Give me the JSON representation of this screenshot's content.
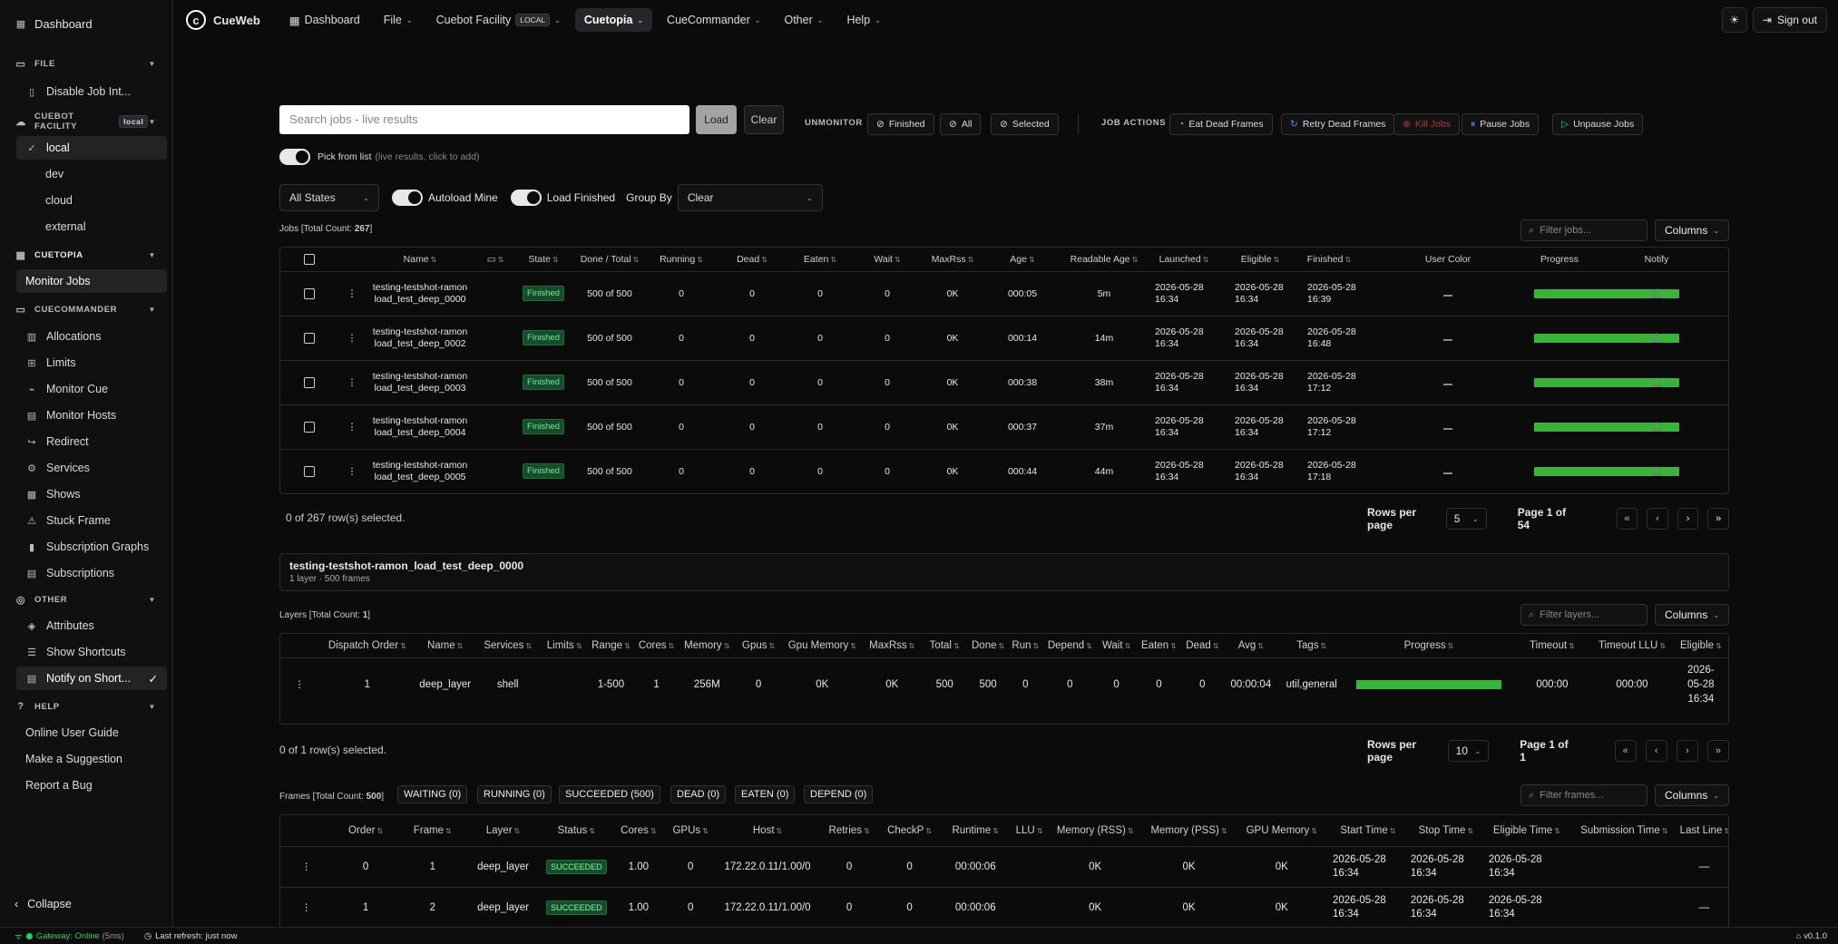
{
  "sidebar": {
    "dashboard": "Dashboard",
    "file": "FILE",
    "disable_job": "Disable Job Int...",
    "cuebot_facility": "CUEBOT FACILITY",
    "facility_tag": "local",
    "facilities": [
      "local",
      "dev",
      "cloud",
      "external"
    ],
    "cuetopia": "CUETOPIA",
    "monitor_jobs": "Monitor Jobs",
    "cuecommander": "CUECOMMANDER",
    "cc_items": [
      "Allocations",
      "Limits",
      "Monitor Cue",
      "Monitor Hosts",
      "Redirect",
      "Services",
      "Shows",
      "Stuck Frame",
      "Subscription Graphs",
      "Subscriptions"
    ],
    "other": "OTHER",
    "other_items": [
      "Attributes",
      "Show Shortcuts",
      "Notify on Short..."
    ],
    "help": "HELP",
    "help_items": [
      "Online User Guide",
      "Make a Suggestion",
      "Report a Bug"
    ],
    "collapse": "Collapse"
  },
  "topbar": {
    "brand": "CueWeb",
    "nav": [
      "Dashboard",
      "File",
      "Cuebot Facility",
      "Cuetopia",
      "CueCommander",
      "Other",
      "Help"
    ],
    "facility_tag": "LOCAL",
    "sign_out": "Sign out"
  },
  "search": {
    "placeholder": "Search jobs - live results",
    "load": "Load",
    "clear": "Clear",
    "pick": "Pick from list",
    "pick_hint": "(live results, click to add)"
  },
  "unmonitor": {
    "label": "UNMONITOR",
    "finished": "Finished",
    "all": "All",
    "selected": "Selected"
  },
  "job_actions": {
    "label": "JOB ACTIONS",
    "eat": "Eat Dead Frames",
    "retry": "Retry Dead Frames",
    "kill": "Kill Jobs",
    "pause": "Pause Jobs",
    "unpause": "Unpause Jobs"
  },
  "filters": {
    "state": "All States",
    "autoload": "Autoload Mine",
    "load_finished": "Load Finished",
    "group_by": "Group By",
    "group_value": "Clear"
  },
  "jobs": {
    "title": "Jobs [Total Count: ",
    "count": "267",
    "title_end": "]",
    "filter_placeholder": "Filter jobs...",
    "columns": "Columns",
    "headers": [
      "Name",
      "",
      "State",
      "Done / Total",
      "Running",
      "Dead",
      "Eaten",
      "Wait",
      "MaxRss",
      "Age",
      "Readable Age",
      "Launched",
      "Eligible",
      "Finished",
      "User Color",
      "Progress",
      "Notify"
    ],
    "rows": [
      {
        "name1": "testing-testshot-ramon",
        "name2": "load_test_deep_0000",
        "state": "Finished",
        "done": "500 of 500",
        "running": "0",
        "dead": "0",
        "eaten": "0",
        "wait": "0",
        "maxrss": "0K",
        "age": "000:05",
        "readable": "5m",
        "launched": "2026-05-28",
        "launched_t": "16:34",
        "eligible": "2026-05-28",
        "eligible_t": "16:34",
        "finished": "2026-05-28",
        "finished_t": "16:39"
      },
      {
        "name1": "testing-testshot-ramon",
        "name2": "load_test_deep_0002",
        "state": "Finished",
        "done": "500 of 500",
        "running": "0",
        "dead": "0",
        "eaten": "0",
        "wait": "0",
        "maxrss": "0K",
        "age": "000:14",
        "readable": "14m",
        "launched": "2026-05-28",
        "launched_t": "16:34",
        "eligible": "2026-05-28",
        "eligible_t": "16:34",
        "finished": "2026-05-28",
        "finished_t": "16:48"
      },
      {
        "name1": "testing-testshot-ramon",
        "name2": "load_test_deep_0003",
        "state": "Finished",
        "done": "500 of 500",
        "running": "0",
        "dead": "0",
        "eaten": "0",
        "wait": "0",
        "maxrss": "0K",
        "age": "000:38",
        "readable": "38m",
        "launched": "2026-05-28",
        "launched_t": "16:34",
        "eligible": "2026-05-28",
        "eligible_t": "16:34",
        "finished": "2026-05-28",
        "finished_t": "17:12"
      },
      {
        "name1": "testing-testshot-ramon",
        "name2": "load_test_deep_0004",
        "state": "Finished",
        "done": "500 of 500",
        "running": "0",
        "dead": "0",
        "eaten": "0",
        "wait": "0",
        "maxrss": "0K",
        "age": "000:37",
        "readable": "37m",
        "launched": "2026-05-28",
        "launched_t": "16:34",
        "eligible": "2026-05-28",
        "eligible_t": "16:34",
        "finished": "2026-05-28",
        "finished_t": "17:12"
      },
      {
        "name1": "testing-testshot-ramon",
        "name2": "load_test_deep_0005",
        "state": "Finished",
        "done": "500 of 500",
        "running": "0",
        "dead": "0",
        "eaten": "0",
        "wait": "0",
        "maxrss": "0K",
        "age": "000:44",
        "readable": "44m",
        "launched": "2026-05-28",
        "launched_t": "16:34",
        "eligible": "2026-05-28",
        "eligible_t": "16:34",
        "finished": "2026-05-28",
        "finished_t": "17:18"
      }
    ],
    "selected": "0 of 267 row(s) selected.",
    "rows_per_page": "Rows per page",
    "rpp": "5",
    "page": "Page 1 of 54",
    "progress": [
      1,
      1,
      1,
      1,
      1
    ]
  },
  "job_detail": {
    "name": "testing-testshot-ramon_load_test_deep_0000",
    "sub": "1 layer · 500 frames"
  },
  "layers": {
    "title": "Layers [Total Count: ",
    "count": "1",
    "title_end": "]",
    "filter_placeholder": "Filter layers...",
    "columns": "Columns",
    "headers": [
      "Dispatch Order",
      "Name",
      "Services",
      "Limits",
      "Range",
      "Cores",
      "Memory",
      "Gpus",
      "Gpu Memory",
      "MaxRss",
      "Total",
      "Done",
      "Run",
      "Depend",
      "Wait",
      "Eaten",
      "Dead",
      "Avg",
      "Tags",
      "Progress",
      "Timeout",
      "Timeout LLU",
      "Eligible"
    ],
    "row": {
      "order": "1",
      "name": "deep_layer",
      "services": "shell",
      "limits": "",
      "range": "1-500",
      "cores": "1",
      "memory": "256M",
      "gpus": "0",
      "gpumem": "0K",
      "maxrss": "0K",
      "total": "500",
      "done": "500",
      "run": "0",
      "depend": "0",
      "wait": "0",
      "eaten": "0",
      "dead": "0",
      "avg": "00:00:04",
      "tags": "util,general",
      "progress": 1,
      "timeout": "000:00",
      "timeout_llu": "000:00",
      "elig1": "2026-",
      "elig2": "05-28",
      "elig3": "16:34"
    },
    "selected": "0 of 1 row(s) selected.",
    "rows_per_page": "Rows per page",
    "rpp": "10",
    "page": "Page 1 of 1"
  },
  "frames": {
    "title": "Frames [Total Count: ",
    "count": "500",
    "title_end": "]",
    "tabs": [
      "WAITING (0)",
      "RUNNING (0)",
      "SUCCEEDED (500)",
      "DEAD (0)",
      "EATEN (0)",
      "DEPEND (0)"
    ],
    "filter_placeholder": "Filter frames...",
    "columns": "Columns",
    "headers": [
      "Order",
      "Frame",
      "Layer",
      "Status",
      "Cores",
      "GPUs",
      "Host",
      "Retries",
      "CheckP",
      "Runtime",
      "LLU",
      "Memory (RSS)",
      "Memory (PSS)",
      "GPU Memory",
      "Start Time",
      "Stop Time",
      "Eligible Time",
      "Submission Time",
      "Last Line"
    ],
    "rows": [
      {
        "order": "0",
        "frame": "1",
        "layer": "deep_layer",
        "status": "SUCCEEDED",
        "cores": "1.00",
        "gpus": "0",
        "host": "172.22.0.11/1.00/0",
        "retries": "0",
        "checkp": "0",
        "runtime": "00:00:06",
        "llu": "",
        "rss": "0K",
        "pss": "0K",
        "gpumem": "0K",
        "start": "2026-05-28",
        "start_t": "16:34",
        "stop": "2026-05-28",
        "stop_t": "16:34",
        "elig": "2026-05-28",
        "elig_t": "16:34",
        "sub": "",
        "last": "—"
      },
      {
        "order": "1",
        "frame": "2",
        "layer": "deep_layer",
        "status": "SUCCEEDED",
        "cores": "1.00",
        "gpus": "0",
        "host": "172.22.0.11/1.00/0",
        "retries": "0",
        "checkp": "0",
        "runtime": "00:00:06",
        "llu": "",
        "rss": "0K",
        "pss": "0K",
        "gpumem": "0K",
        "start": "2026-05-28",
        "start_t": "16:34",
        "stop": "2026-05-28",
        "stop_t": "16:34",
        "elig": "2026-05-28",
        "elig_t": "16:34",
        "sub": "",
        "last": "—"
      }
    ]
  },
  "statusbar": {
    "gateway": "Gateway: Online",
    "latency": "(5ms)",
    "refresh": "Last refresh: just now",
    "version": "v0.1.0"
  }
}
